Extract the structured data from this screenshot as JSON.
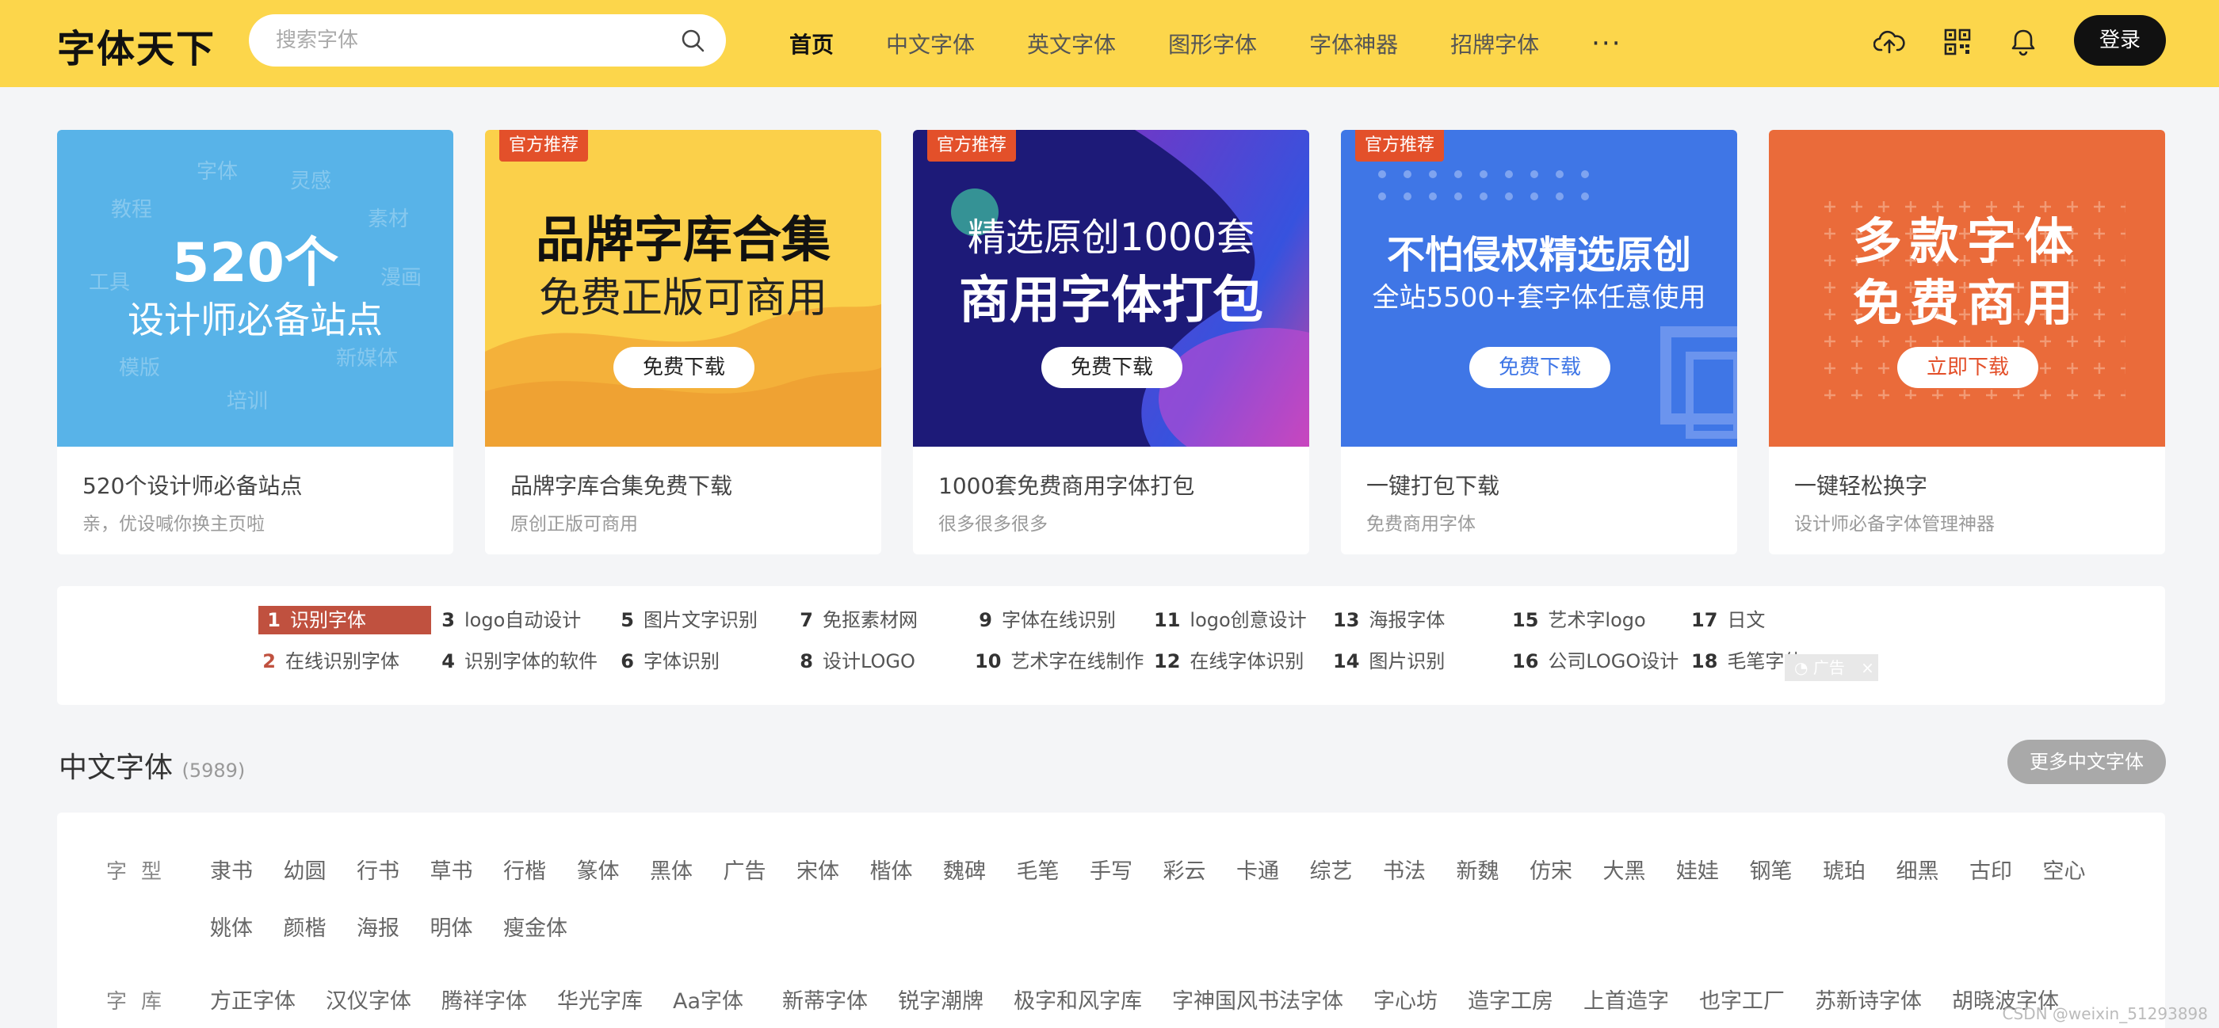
{
  "header": {
    "logo": "字体天下",
    "search_placeholder": "搜索字体",
    "nav": [
      "首页",
      "中文字体",
      "英文字体",
      "图形字体",
      "字体神器",
      "招牌字体"
    ],
    "more": "···",
    "login": "登录",
    "icons": [
      "upload-cloud-icon",
      "qrcode-icon",
      "bell-icon"
    ]
  },
  "cards": [
    {
      "banner": {
        "big": "520个",
        "line2": "设计师必备站点",
        "floats": [
          "字体",
          "灵感",
          "教程",
          "素材",
          "工具",
          "漫画",
          "模版",
          "新媒体",
          "培训"
        ]
      },
      "title": "520个设计师必备站点",
      "sub": "亲，优设喊你换主页啦"
    },
    {
      "tag": "官方推荐",
      "banner": {
        "line1": "品牌字库合集",
        "line2": "免费正版可商用",
        "button": "免费下载"
      },
      "title": "品牌字库合集免费下载",
      "sub": "原创正版可商用"
    },
    {
      "tag": "官方推荐",
      "banner": {
        "line1": "精选原创1000套",
        "line2": "商用字体打包",
        "button": "免费下载"
      },
      "title": "1000套免费商用字体打包",
      "sub": "很多很多很多"
    },
    {
      "tag": "官方推荐",
      "banner": {
        "line1": "不怕侵权精选原创",
        "line2": "全站5500+套字体任意使用",
        "button": "免费下载"
      },
      "title": "一键打包下载",
      "sub": "免费商用字体"
    },
    {
      "banner": {
        "line1": "多款字体",
        "line2": "免费商用",
        "button": "立即下载"
      },
      "title": "一键轻松换字",
      "sub": "设计师必备字体管理神器"
    }
  ],
  "hot_keywords": [
    {
      "num": "1",
      "text": "识别字体"
    },
    {
      "num": "2",
      "text": "在线识别字体"
    },
    {
      "num": "3",
      "text": "logo自动设计"
    },
    {
      "num": "4",
      "text": "识别字体的软件"
    },
    {
      "num": "5",
      "text": "图片文字识别"
    },
    {
      "num": "6",
      "text": "字体识别"
    },
    {
      "num": "7",
      "text": "免抠素材网"
    },
    {
      "num": "8",
      "text": "设计LOGO"
    },
    {
      "num": "9",
      "text": "字体在线识别"
    },
    {
      "num": "10",
      "text": "艺术字在线制作"
    },
    {
      "num": "11",
      "text": "logo创意设计"
    },
    {
      "num": "12",
      "text": "在线字体识别"
    },
    {
      "num": "13",
      "text": "海报字体"
    },
    {
      "num": "14",
      "text": "图片识别"
    },
    {
      "num": "15",
      "text": "艺术字logo"
    },
    {
      "num": "16",
      "text": "公司LOGO设计"
    },
    {
      "num": "17",
      "text": "日文"
    },
    {
      "num": "18",
      "text": "毛笔字体"
    }
  ],
  "ad_label": "广告",
  "ad_close": "×",
  "section": {
    "title": "中文字体",
    "count": "(5989)",
    "more": "更多中文字体"
  },
  "filters": {
    "type_label": "字型",
    "types_row1": [
      "隶书",
      "幼圆",
      "行书",
      "草书",
      "行楷",
      "篆体",
      "黑体",
      "广告",
      "宋体",
      "楷体",
      "魏碑",
      "毛笔",
      "手写",
      "彩云",
      "卡通",
      "综艺",
      "书法",
      "新魏",
      "仿宋",
      "大黑",
      "娃娃",
      "钢笔",
      "琥珀",
      "细黑",
      "古印",
      "空心"
    ],
    "types_row2": [
      "姚体",
      "颜楷",
      "海报",
      "明体",
      "瘦金体"
    ],
    "lib_label": "字库",
    "libs": [
      "方正字体",
      "汉仪字体",
      "腾祥字体",
      "华光字库",
      "Aa字体",
      "新蒂字体",
      "锐字潮牌",
      "极字和风字库",
      "字神国风书法字体",
      "字心坊",
      "造字工房",
      "上首造字",
      "也字工厂",
      "苏新诗字体",
      "胡晓波字体"
    ]
  },
  "watermark": "CSDN @weixin_51293898",
  "colors": {
    "header": "#fcd64b",
    "accent_red": "#c0513f",
    "tag": "#e3502a"
  }
}
